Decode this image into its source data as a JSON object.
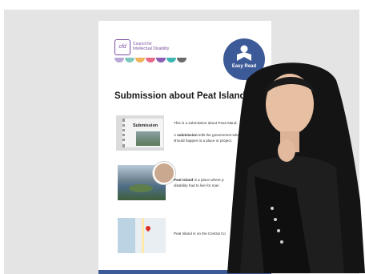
{
  "document": {
    "logo_mark": "cfd",
    "logo_text_line1": "Council for",
    "logo_text_line2": "Intellectual Disability",
    "badge_label": "Easy Read",
    "title": "Submission about Peat Island",
    "thumb1_caption": "Submission",
    "para1": "This is a submission about Peat Island.",
    "para2_bold": "submission",
    "para2_pre": "A",
    "para2_post": "tells the government what",
    "para2_line2": "should happen to a place or project.",
    "para3_bold": "Peat Island",
    "para3_post": "is a place where p",
    "para3_line2": "disability had to live for man",
    "para4": "Peat Island is on the Central Co"
  },
  "colors": {
    "accent_blue": "#3d5a98",
    "logo_purple": "#7a4fa0",
    "dot_colors": [
      "#b9a7d8",
      "#7ec8c0",
      "#f0b35a",
      "#e86a8a",
      "#8c5fb4",
      "#3db5b0",
      "#6a6a6a"
    ]
  },
  "icons": {
    "badge_icon": "person-reading-icon",
    "map_pin": "map-pin-icon"
  }
}
